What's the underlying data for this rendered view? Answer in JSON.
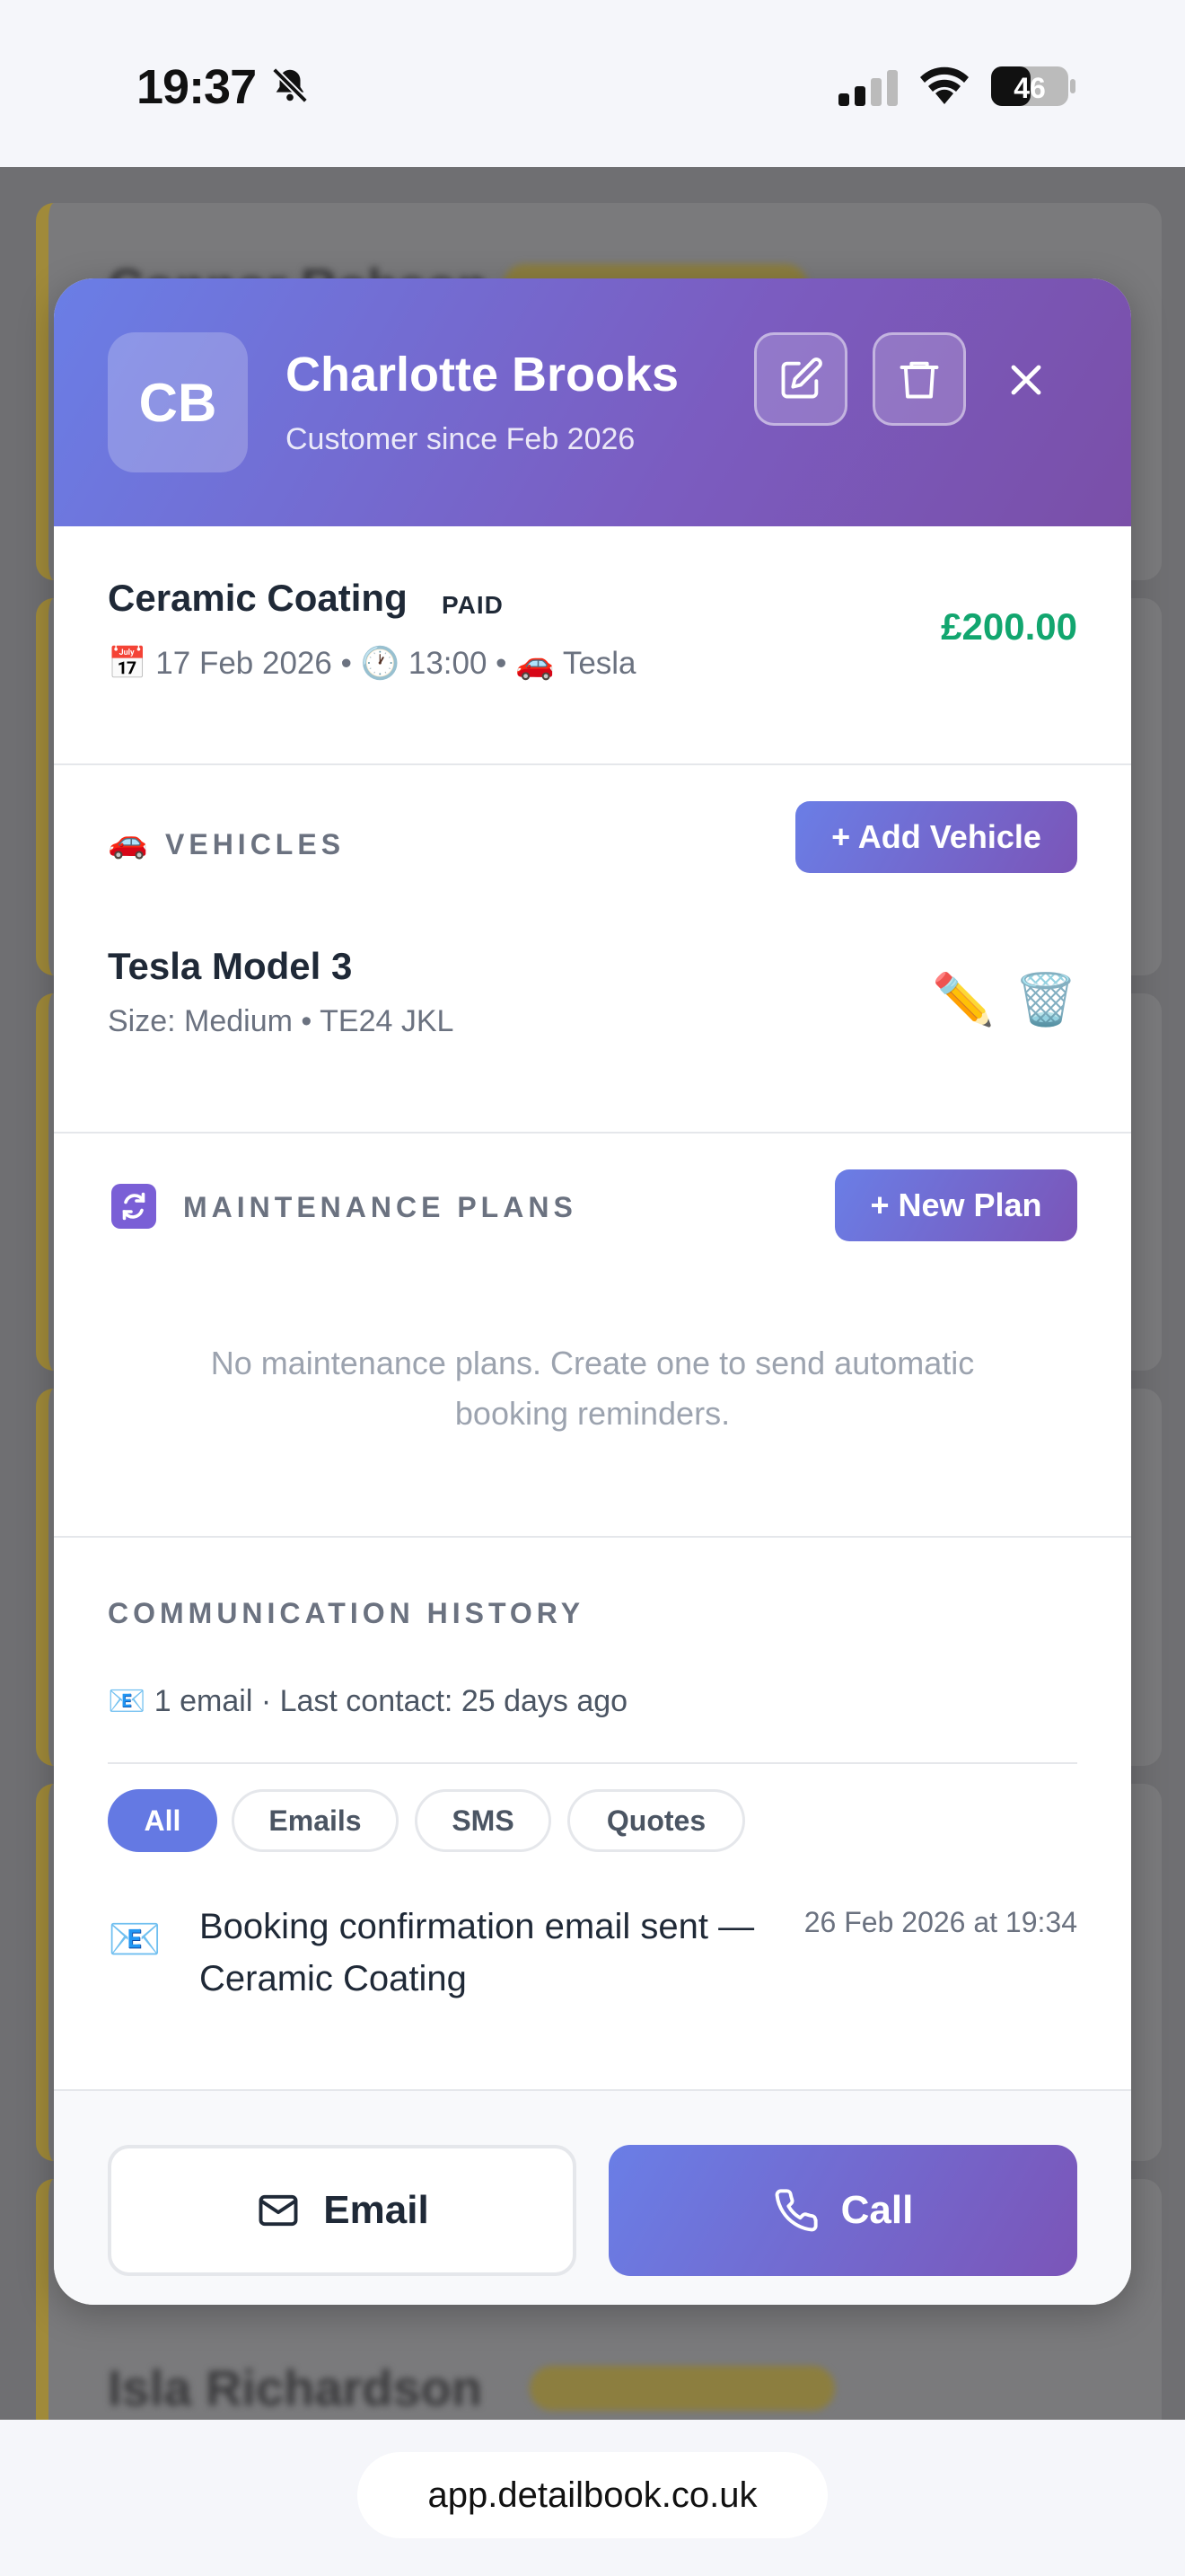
{
  "status_bar": {
    "time": "19:37",
    "battery": "46"
  },
  "background_list": {
    "names": [
      "Connor Robson",
      "Isla Richardson"
    ]
  },
  "customer": {
    "initials": "CB",
    "name": "Charlotte Brooks",
    "since": "Customer since Feb 2026"
  },
  "header_actions": {
    "edit_icon": "edit-icon",
    "delete_icon": "trash-icon",
    "close_icon": "close-icon"
  },
  "booking": {
    "service": "Ceramic Coating",
    "status": "PAID",
    "price": "£200.00",
    "meta": "📅 17 Feb 2026 • 🕐 13:00 • 🚗 Tesla"
  },
  "vehicles": {
    "icon": "🚗",
    "label": "VEHICLES",
    "add_label": "+ Add Vehicle",
    "items": [
      {
        "name": "Tesla Model 3",
        "meta": "Size: Medium • TE24 JKL",
        "edit_icon": "✏️",
        "delete_icon": "🗑️"
      }
    ]
  },
  "maintenance": {
    "label": "MAINTENANCE PLANS",
    "new_label": "+ New Plan",
    "empty": "No maintenance plans. Create one to send automatic booking reminders."
  },
  "communication": {
    "label": "COMMUNICATION HISTORY",
    "stats": "📧 1 email · Last contact: 25 days ago",
    "filters": [
      "All",
      "Emails",
      "SMS",
      "Quotes"
    ],
    "active_filter": "All",
    "entries": [
      {
        "icon": "📧",
        "text": "Booking confirmation email sent — Ceramic Coating",
        "time": "26 Feb 2026 at 19:34"
      }
    ]
  },
  "footer": {
    "email_label": "Email",
    "call_label": "Call"
  },
  "browser": {
    "url": "app.detailbook.co.uk"
  },
  "colors": {
    "accent_start": "#6a7ee6",
    "accent_end": "#7b55b8",
    "price_green": "#12a66f"
  }
}
